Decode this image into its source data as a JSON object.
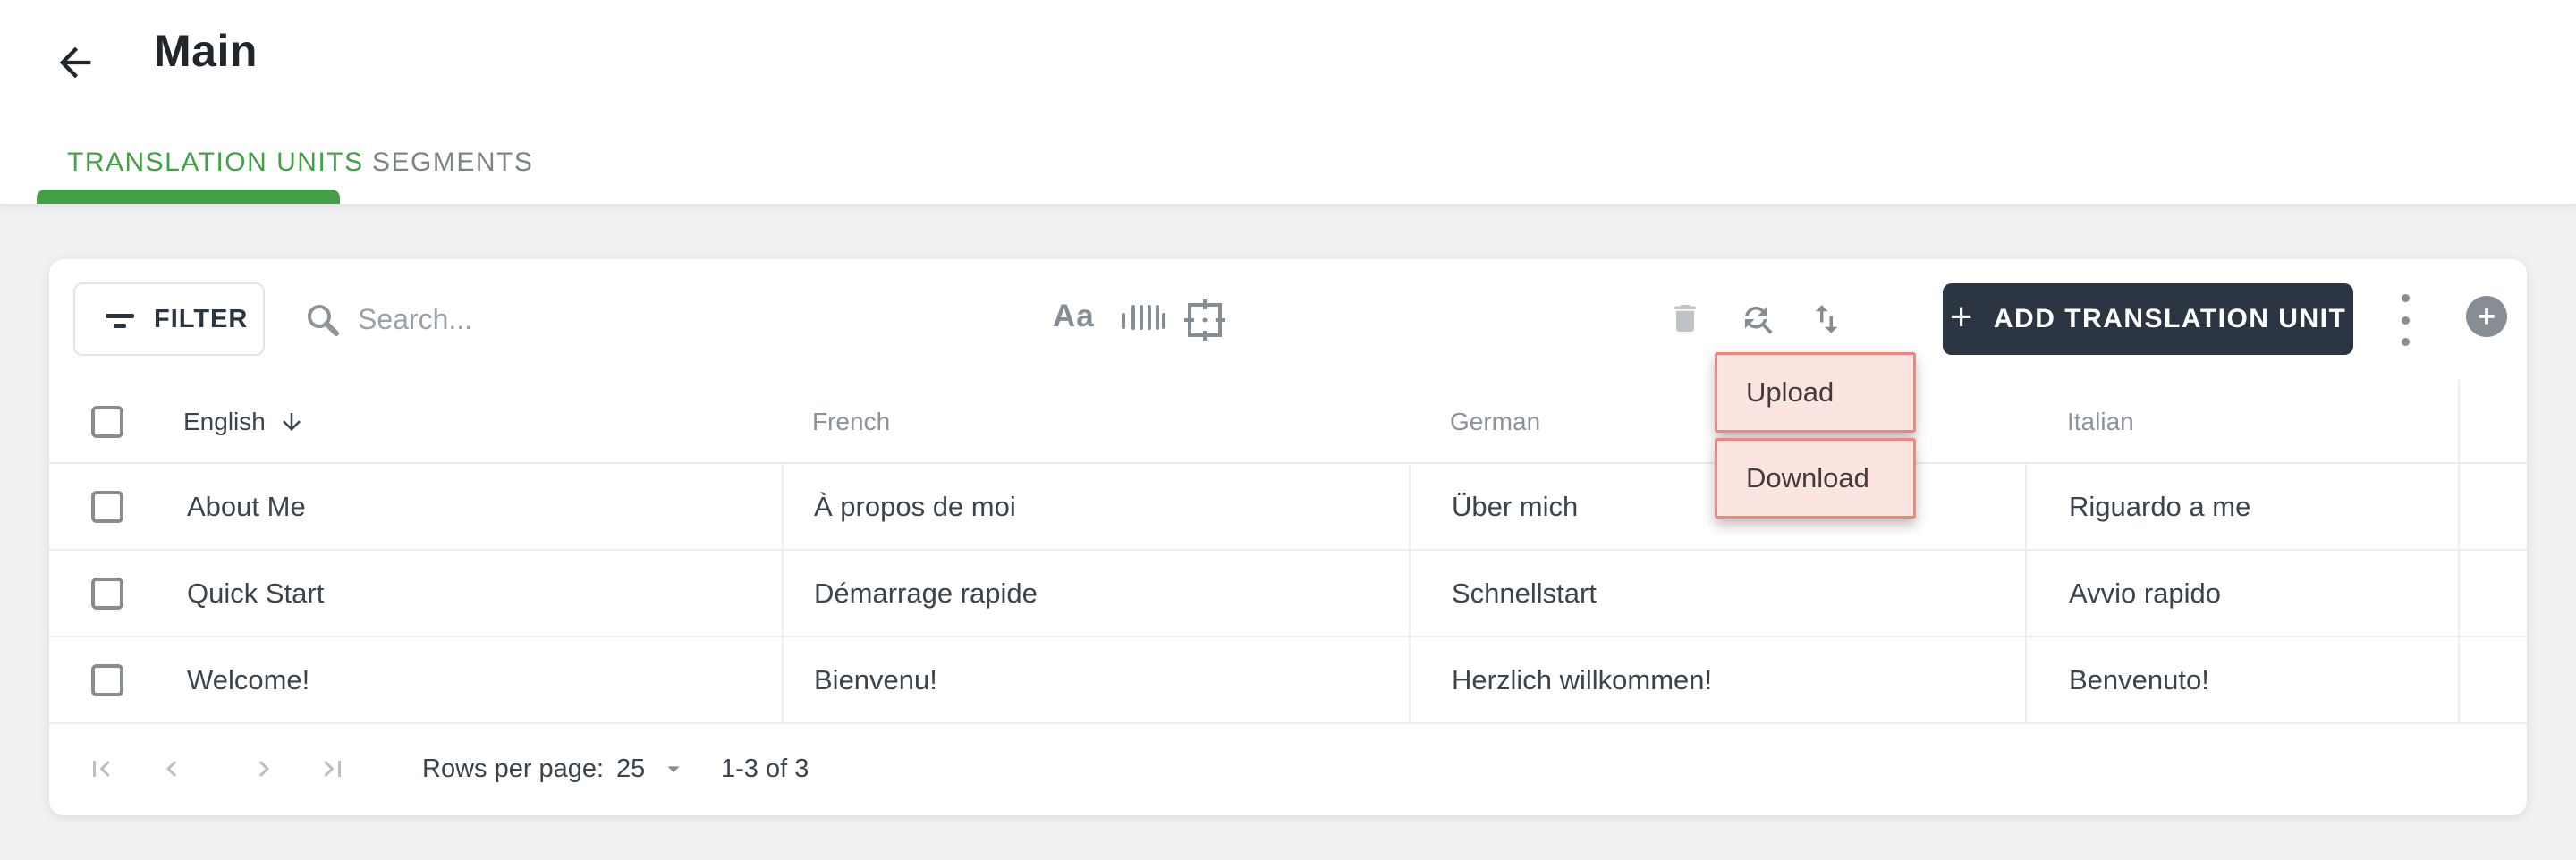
{
  "page": {
    "title": "Main"
  },
  "tabs": {
    "translation_units": "TRANSLATION UNITS",
    "segments": "SEGMENTS"
  },
  "toolbar": {
    "filter_label": "FILTER",
    "search_placeholder": "Search...",
    "add_button_label": "ADD TRANSLATION UNIT",
    "add_button_plus": "+",
    "aa_icon_text": "Aa",
    "icons": [
      "font-case-icon",
      "barcode-icon",
      "frame-capture-icon",
      "trash-icon",
      "find-replace-icon",
      "import-export-icon",
      "kebab-menu-icon",
      "plus-circle-icon"
    ]
  },
  "menu": {
    "items": [
      {
        "label": "Upload"
      },
      {
        "label": "Download"
      }
    ]
  },
  "table": {
    "columns": [
      {
        "label": "English",
        "sorted": "desc"
      },
      {
        "label": "French"
      },
      {
        "label": "German"
      },
      {
        "label": "Italian"
      }
    ],
    "rows": [
      [
        "About Me",
        "À propos de moi",
        "Über mich",
        "Riguardo a me"
      ],
      [
        "Quick Start",
        "Démarrage rapide",
        "Schnellstart",
        "Avvio rapido"
      ],
      [
        "Welcome!",
        "Bienvenu!",
        "Herzlich willkommen!",
        "Benvenuto!"
      ]
    ]
  },
  "pagination": {
    "rows_per_page_label": "Rows per page:",
    "rows_per_page_value": "25",
    "range_label": "1-3 of 3"
  },
  "colors": {
    "accent_green": "#43a047",
    "dark_button": "#2b3642",
    "menu_highlight_bg": "#fce4e1",
    "menu_highlight_border": "#f0857c",
    "page_bg": "#eff1f2",
    "icon_gray": "#848e94",
    "disabled_icon_gray": "#bdc3c7"
  }
}
